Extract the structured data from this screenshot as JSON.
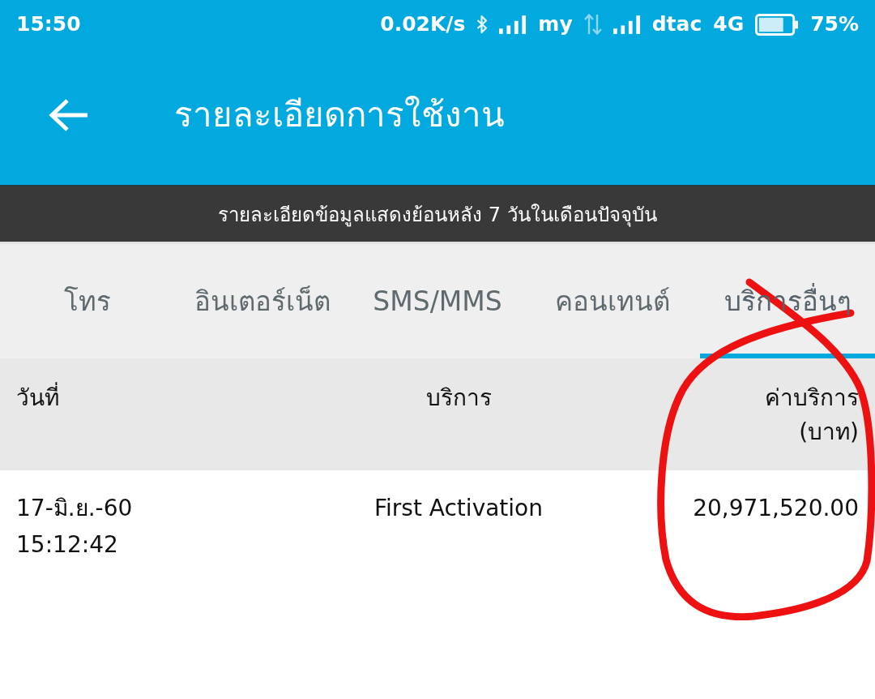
{
  "status_bar": {
    "time": "15:50",
    "indicators": [
      {
        "kind": "speed",
        "text": "0.02K/s"
      },
      {
        "kind": "bluetooth"
      },
      {
        "kind": "signal"
      },
      {
        "kind": "carrier",
        "text": "my"
      },
      {
        "kind": "data"
      },
      {
        "kind": "signal"
      },
      {
        "kind": "carrier",
        "text": "dtac"
      },
      {
        "kind": "network",
        "text": "4G"
      },
      {
        "kind": "battery"
      },
      {
        "kind": "battery_text",
        "text": "75%"
      }
    ]
  },
  "header": {
    "title": "รายละเอียดการใช้งาน"
  },
  "notice": "รายละเอียดข้อมูลแสดงย้อนหลัง 7 วันในเดือนปัจจุบัน",
  "tabs": [
    {
      "label": "โทร",
      "selected": false
    },
    {
      "label": "อินเตอร์เน็ต",
      "selected": false
    },
    {
      "label": "SMS/MMS",
      "selected": false
    },
    {
      "label": "คอนเทนต์",
      "selected": false
    },
    {
      "label": "บริการอื่นๆ",
      "selected": true
    }
  ],
  "table": {
    "columns": [
      {
        "label": "วันที่"
      },
      {
        "label": "บริการ"
      },
      {
        "label": "ค่าบริการ",
        "unit": "(บาท)"
      }
    ],
    "rows": [
      {
        "date": "17-มิ.ย.-60",
        "time": "15:12:42",
        "service": "First Activation",
        "charge": "20,971,520.00"
      }
    ]
  },
  "annotations": [
    {
      "kind": "circle"
    }
  ]
}
